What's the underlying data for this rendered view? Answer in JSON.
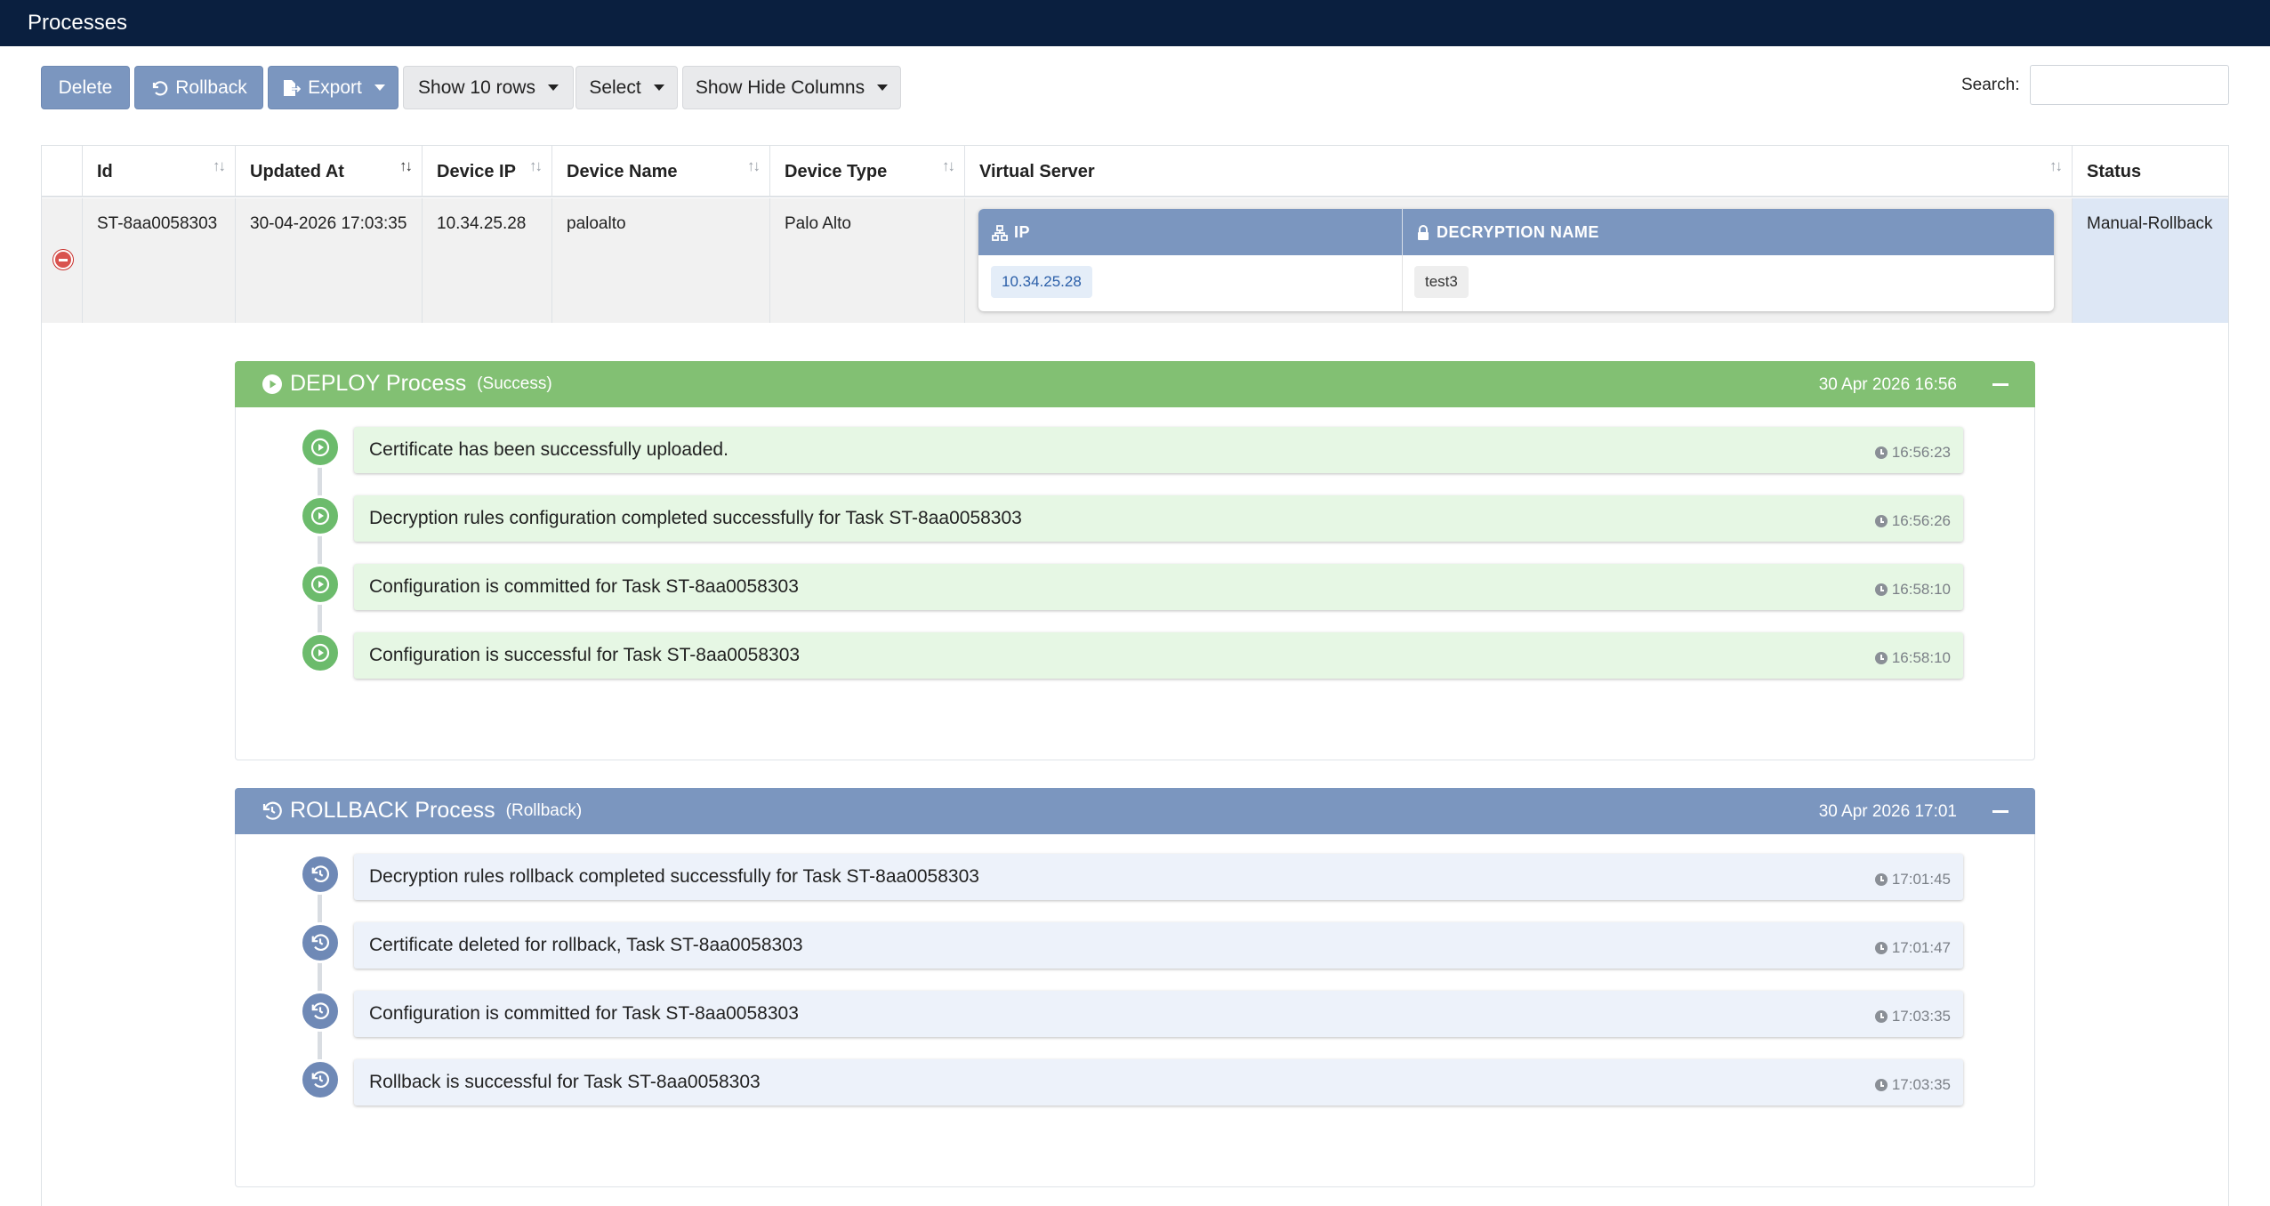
{
  "header": {
    "title": "Processes"
  },
  "toolbar": {
    "delete_label": "Delete",
    "rollback_label": "Rollback",
    "export_label": "Export",
    "rows_label": "Show 10 rows",
    "select_label": "Select",
    "columns_label": "Show Hide Columns",
    "search_label": "Search:",
    "search_value": ""
  },
  "table": {
    "columns": [
      "Id",
      "Updated At",
      "Device IP",
      "Device Name",
      "Device Type",
      "Virtual Server",
      "Status"
    ],
    "row": {
      "id": "ST-8aa0058303",
      "updated_at": "30-04-2026 17:03:35",
      "device_ip": "10.34.25.28",
      "device_name": "paloalto",
      "device_type": "Palo Alto",
      "status": "Manual-Rollback",
      "virtual_server": {
        "headers": [
          "IP",
          "DECRYPTION NAME"
        ],
        "ip": "10.34.25.28",
        "decryption_name": "test3"
      }
    }
  },
  "processes": [
    {
      "title": "DEPLOY Process",
      "subtitle": "(Success)",
      "date": "30 Apr 2026 16:56",
      "color": "#82c073",
      "icon": "play-circle-icon",
      "steps": [
        {
          "message": "Certificate has been successfully uploaded.",
          "time": "16:56:23"
        },
        {
          "message": "Decryption rules configuration completed successfully for Task ST-8aa0058303",
          "time": "16:56:26"
        },
        {
          "message": "Configuration is committed for Task ST-8aa0058303",
          "time": "16:58:10"
        },
        {
          "message": "Configuration is successful for Task ST-8aa0058303",
          "time": "16:58:10"
        }
      ]
    },
    {
      "title": "ROLLBACK Process",
      "subtitle": "(Rollback)",
      "date": "30 Apr 2026 17:01",
      "color": "#7b96bf",
      "icon": "history-icon",
      "steps": [
        {
          "message": "Decryption rules rollback completed successfully for Task ST-8aa0058303",
          "time": "17:01:45"
        },
        {
          "message": "Certificate deleted for rollback, Task ST-8aa0058303",
          "time": "17:01:47"
        },
        {
          "message": "Configuration is committed for Task ST-8aa0058303",
          "time": "17:03:35"
        },
        {
          "message": "Rollback is successful for Task ST-8aa0058303",
          "time": "17:03:35"
        }
      ]
    }
  ]
}
